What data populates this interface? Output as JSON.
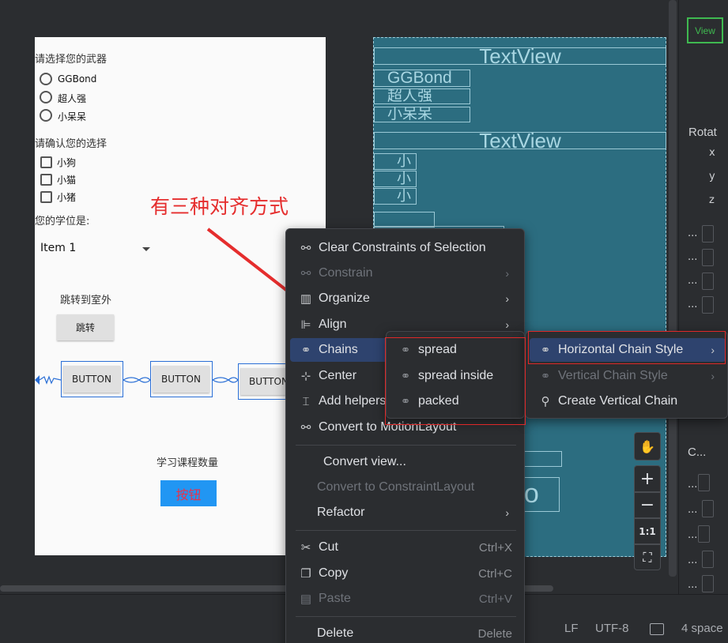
{
  "phone": {
    "weapon_label": "请选择您的武器",
    "weapons": [
      "GGBond",
      "超人强",
      "小呆呆"
    ],
    "confirm_label": "请确认您的选择",
    "checks": [
      "小狗",
      "小猫",
      "小猪"
    ],
    "degree_label": "您的学位是:",
    "spinner_value": "Item 1",
    "jump_label": "跳转到室外",
    "jump_button": "跳转",
    "chain_buttons": [
      "BUTTON",
      "BUTTON",
      "BUTTON"
    ],
    "course_label": "学习课程数量",
    "action_button": "按钮"
  },
  "blueprint": {
    "textview1": "TextView",
    "radios": [
      "GGBond",
      "超人强",
      "小呆呆"
    ],
    "textview2": "TextView",
    "checks": [
      "小",
      "小",
      "小"
    ],
    "bottom_button": "tto"
  },
  "annotation": "有三种对齐方式",
  "right_panel": {
    "view_badge": "View",
    "rotate_label": "Rotat",
    "axes": [
      "x",
      "y",
      "z"
    ],
    "section_label": "C...",
    "dots": "..."
  },
  "zoom": {
    "pan": "✋",
    "zoom_in": "+",
    "zoom_out": "−",
    "actual": "1:1",
    "fit": "⛶"
  },
  "context_menu": {
    "items": [
      {
        "label": "Clear Constraints of Selection",
        "icon": "clear-constraints-icon",
        "glyph": "⚯",
        "enabled": true
      },
      {
        "label": "Constrain",
        "icon": "constrain-icon",
        "glyph": "⚯",
        "enabled": false,
        "submenu": true
      },
      {
        "label": "Organize",
        "icon": "organize-icon",
        "glyph": "▥",
        "enabled": true,
        "submenu": true
      },
      {
        "label": "Align",
        "icon": "align-icon",
        "glyph": "⊫",
        "enabled": true,
        "submenu": true
      },
      {
        "label": "Chains",
        "icon": "chains-icon",
        "glyph": "⚭",
        "enabled": true,
        "submenu": true,
        "active": true
      },
      {
        "label": "Center",
        "icon": "center-icon",
        "glyph": "⊹",
        "enabled": true,
        "submenu": true
      },
      {
        "label": "Add helpers",
        "icon": "helpers-icon",
        "glyph": "⌶",
        "enabled": true,
        "submenu": true
      },
      {
        "label": "Convert to MotionLayout",
        "icon": "motion-icon",
        "glyph": "⚯",
        "enabled": true
      },
      {
        "label": "Convert view...",
        "enabled": true
      },
      {
        "label": "Convert to ConstraintLayout",
        "enabled": false
      },
      {
        "label": "Refactor",
        "enabled": true,
        "submenu": true
      },
      {
        "label": "Cut",
        "icon": "cut-icon",
        "glyph": "✂",
        "shortcut": "Ctrl+X",
        "enabled": true
      },
      {
        "label": "Copy",
        "icon": "copy-icon",
        "glyph": "❐",
        "shortcut": "Ctrl+C",
        "enabled": true
      },
      {
        "label": "Paste",
        "icon": "paste-icon",
        "glyph": "▤",
        "shortcut": "Ctrl+V",
        "enabled": false
      },
      {
        "label": "Delete",
        "shortcut": "Delete",
        "enabled": true
      }
    ]
  },
  "chains_submenu": [
    {
      "label": "spread"
    },
    {
      "label": "spread inside"
    },
    {
      "label": "packed"
    }
  ],
  "chain_style_submenu": [
    {
      "label": "Horizontal Chain Style",
      "enabled": true,
      "submenu": true,
      "active": true
    },
    {
      "label": "Vertical Chain Style",
      "enabled": false,
      "submenu": true
    },
    {
      "label": "Create Vertical Chain",
      "enabled": true
    }
  ],
  "status_bar": {
    "line_sep": "LF",
    "encoding": "UTF-8",
    "indent": "4 space"
  },
  "colors": {
    "accent": "#2e436e",
    "annotation_red": "#e52d2d",
    "blueprint": "#2c6d80"
  }
}
